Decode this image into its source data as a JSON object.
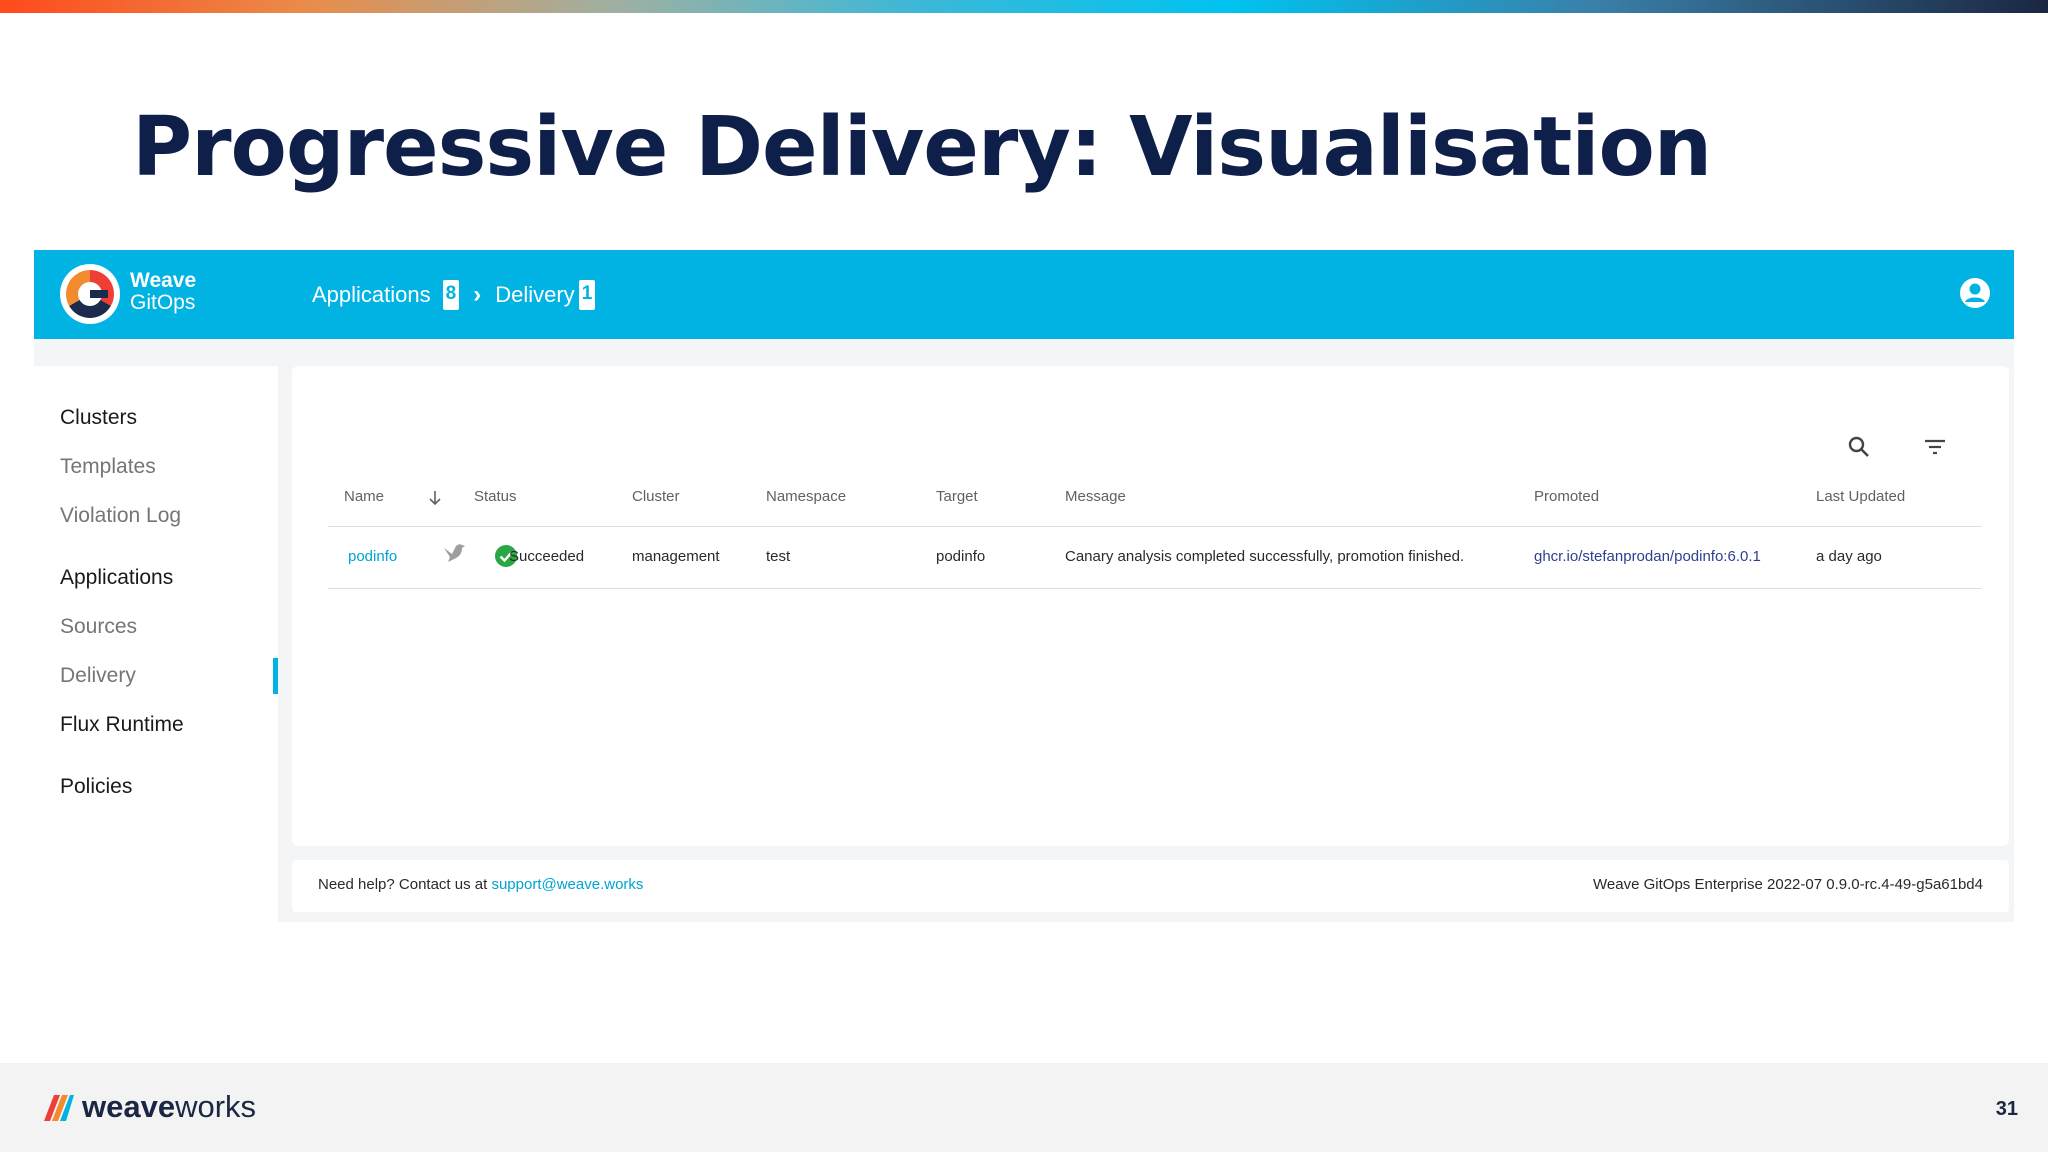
{
  "slide": {
    "title": "Progressive Delivery: Visualisation",
    "page_number": "31",
    "brand_bold": "weave",
    "brand_regular": "works"
  },
  "header": {
    "logo_line1": "Weave",
    "logo_line2": "GitOps",
    "breadcrumb": [
      {
        "label": "Applications",
        "count": "8"
      },
      {
        "label": "Delivery",
        "count": "1"
      }
    ],
    "accent_color": "#00b3e3"
  },
  "sidebar": {
    "items": [
      {
        "label": "Clusters"
      },
      {
        "label": "Templates"
      },
      {
        "label": "Violation Log"
      },
      {
        "label": "Applications"
      },
      {
        "label": "Sources"
      },
      {
        "label": "Delivery",
        "active": true
      },
      {
        "label": "Flux Runtime"
      },
      {
        "label": "Policies"
      }
    ]
  },
  "table": {
    "headers": [
      "Name",
      "Status",
      "Cluster",
      "Namespace",
      "Target",
      "Message",
      "Promoted",
      "Last Updated"
    ],
    "rows": [
      {
        "name": "podinfo",
        "status": "Succeeded",
        "cluster": "management",
        "namespace": "test",
        "target": "podinfo",
        "message": "Canary analysis completed successfully, promotion finished.",
        "promoted": "ghcr.io/stefanprodan/podinfo:6.0.1",
        "last_updated": "a day ago"
      }
    ]
  },
  "footer": {
    "help_text": "Need help? Contact us at",
    "help_link": "support@weave.works",
    "version": "Weave GitOps Enterprise 2022-07 0.9.0-rc.4-49-g5a61bd4"
  }
}
